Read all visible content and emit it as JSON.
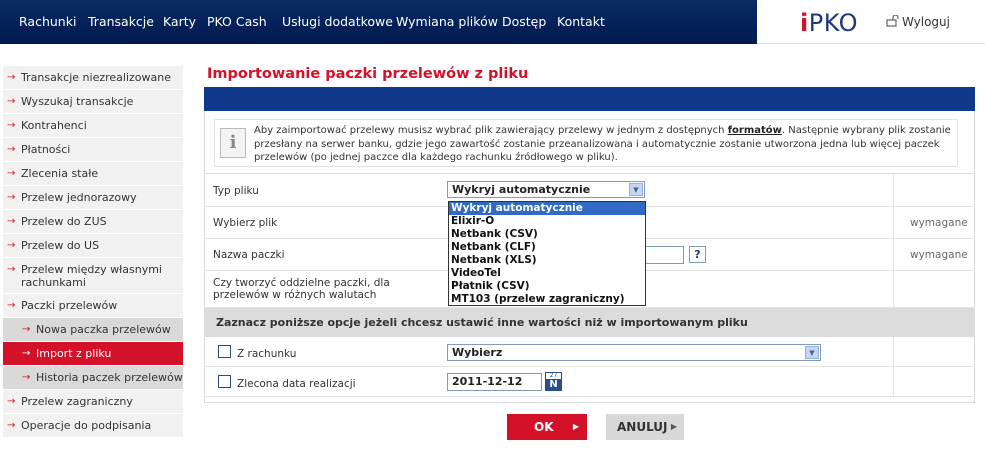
{
  "nav": {
    "items": [
      "Rachunki",
      "Transakcje",
      "Karty",
      "PKO Cash",
      "Usługi dodatkowe",
      "Wymiana plików",
      "Dostęp",
      "Kontakt"
    ]
  },
  "brand": {
    "logo_i": "i",
    "logo_rest": "PKO"
  },
  "logout_label": "Wyloguj",
  "sidebar": {
    "items": [
      "Transakcje niezrealizowane",
      "Wyszukaj transakcje",
      "Kontrahenci",
      "Płatności",
      "Zlecenia stałe",
      "Przelew jednorazowy",
      "Przelew do ZUS",
      "Przelew do US",
      "Przelew między własnymi rachunkami",
      "Paczki przelewów",
      "Nowa paczka przelewów",
      "Import z pliku",
      "Historia paczek przelewów",
      "Przelew zagraniczny",
      "Operacje do podpisania"
    ],
    "active": "Import z pliku"
  },
  "page_title": "Importowanie paczki przelewów z pliku",
  "info": {
    "text_before": "Aby zaimportować przelewy musisz wybrać plik zawierający przelewy w jednym z dostępnych ",
    "link": "formatów",
    "text_after": ". Następnie wybrany plik zostanie przesłany na serwer banku, gdzie jego zawartość zostanie przeanalizowana i automatycznie zostanie utworzona jedna lub więcej paczek przelewów (po jednej paczce dla każdego rachunku źródłowego w pliku).",
    "icon_glyph": "i"
  },
  "form": {
    "file_type_label": "Typ pliku",
    "file_type_value": "Wykryj automatycznie",
    "file_type_options": [
      "Wykryj automatycznie",
      "Elixir-O",
      "Netbank (CSV)",
      "Netbank (CLF)",
      "Netbank (XLS)",
      "VideoTel",
      "Płatnik (CSV)",
      "MT103 (przelew zagraniczny)"
    ],
    "choose_file_label": "Wybierz plik",
    "package_name_label": "Nazwa paczki",
    "separate_label": "Czy tworzyć oddzielne paczki, dla przelewów w różnych walutach",
    "required_text": "wymagane",
    "help_glyph": "?",
    "section_heading": "Zaznacz poniższe opcje jeżeli chcesz ustawić inne wartości niż w importowanym pliku",
    "from_account_label": "Z rachunku",
    "from_account_value": "Wybierz",
    "date_label": "Zlecona data realizacji",
    "date_value": "2011-12-12",
    "cal_top": "27",
    "cal_letter": "N"
  },
  "buttons": {
    "ok": "OK",
    "cancel": "ANULUJ"
  },
  "colors": {
    "brand_red": "#d3122a",
    "navy": "#0f3a8c"
  }
}
